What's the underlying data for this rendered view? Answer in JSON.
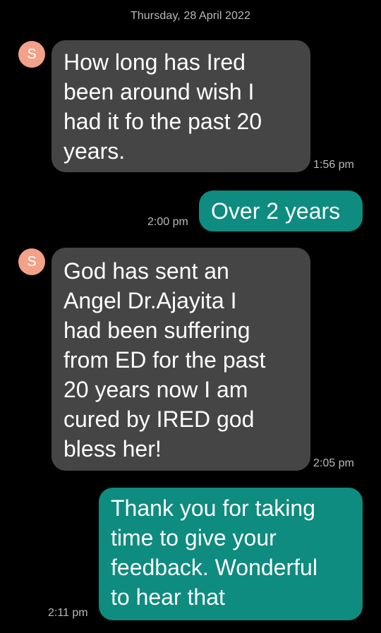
{
  "conversation": {
    "date": "Thursday, 28 April 2022",
    "messages": [
      {
        "direction": "incoming",
        "avatar_letter": "S",
        "text": "How long has Ired\nbeen around wish I\nhad it fo the past 20\nyears.",
        "time": "1:56 pm"
      },
      {
        "direction": "outgoing",
        "text": "Over 2 years",
        "time": "2:00 pm"
      },
      {
        "direction": "incoming",
        "avatar_letter": "S",
        "text": "God has sent an\nAngel Dr.Ajayita I\nhad been suffering\nfrom ED for the past\n20 years now I am\ncured by IRED god\nbless her!",
        "time": "2:05 pm"
      },
      {
        "direction": "outgoing",
        "text": "Thank you for taking\ntime to give your\nfeedback. Wonderful\nto hear that",
        "time": "2:11 pm"
      }
    ]
  },
  "colors": {
    "background": "#000000",
    "incoming_bubble": "#454545",
    "outgoing_bubble": "#0d8c7f",
    "avatar": "#f3a189",
    "timestamp": "#b9b9b9"
  }
}
